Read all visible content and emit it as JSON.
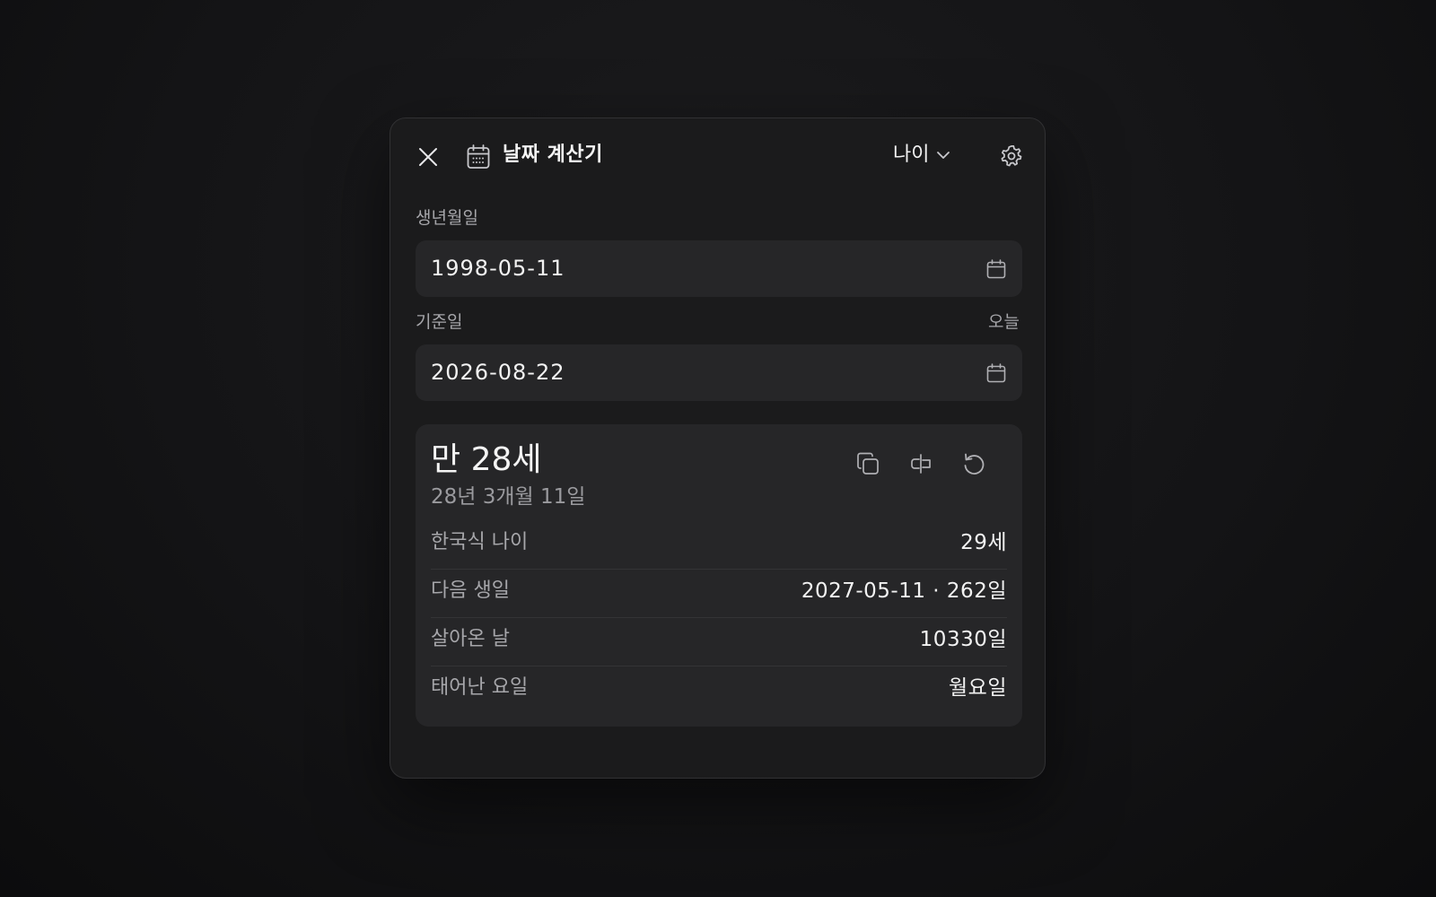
{
  "header": {
    "title": "날짜 계산기",
    "mode_selected": "나이"
  },
  "icons": {
    "close": "close-icon",
    "title": "calendar-icon",
    "mode": "chevron-down-icon",
    "settings": "gear-icon",
    "date_picker": "calendar-icon",
    "copy": "copy-icon",
    "swap": "swap-icon",
    "reset": "reset-icon"
  },
  "birth": {
    "label": "생년월일",
    "value": "1998-05-11"
  },
  "reference": {
    "label": "기준일",
    "today_label": "오늘",
    "value": "2026-08-22"
  },
  "result": {
    "main": "만 28세",
    "sub": "28년 3개월 11일",
    "rows": [
      {
        "label": "한국식 나이",
        "value": "29세"
      },
      {
        "label": "다음 생일",
        "value": "2027-05-11 · 262일"
      },
      {
        "label": "살아온 날",
        "value": "10330일"
      },
      {
        "label": "태어난 요일",
        "value": "월요일"
      }
    ]
  },
  "colors": {
    "background": "#141416",
    "panel": "#1b1b1c",
    "field": "#262628",
    "text": "#f2f2f2",
    "muted": "#a6a6aa"
  }
}
